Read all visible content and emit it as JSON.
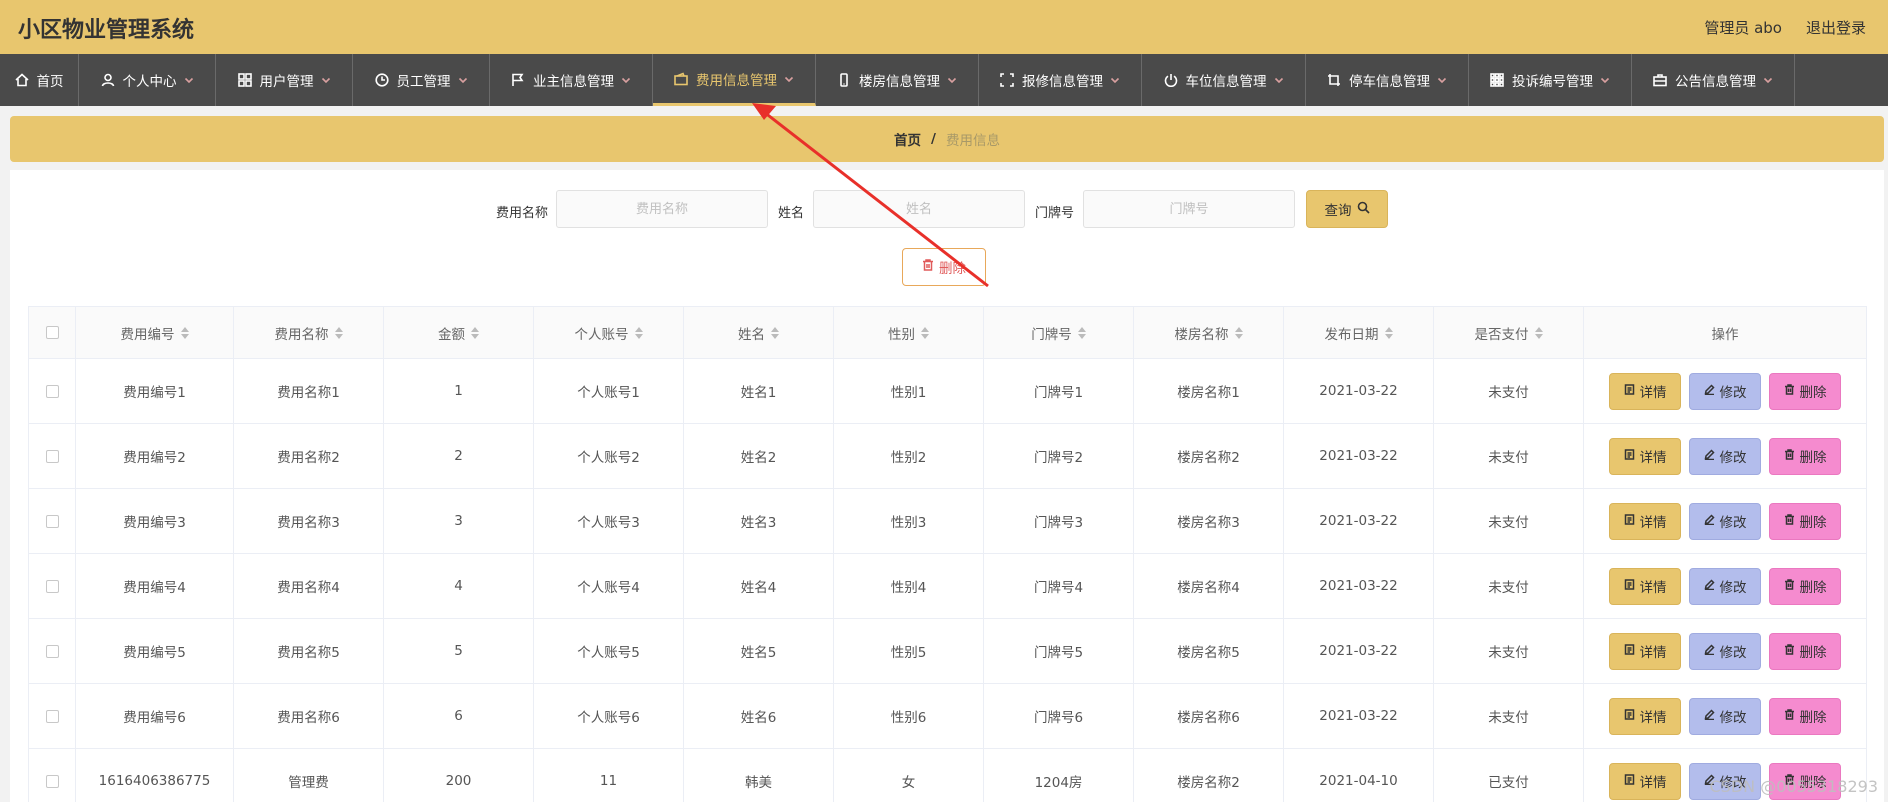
{
  "header": {
    "title": "小区物业管理系统",
    "admin_label": "管理员 abo",
    "logout": "退出登录"
  },
  "nav": {
    "home": "首页",
    "items": [
      {
        "label": "个人中心",
        "icon": "user-icon"
      },
      {
        "label": "用户管理",
        "icon": "grid-icon"
      },
      {
        "label": "员工管理",
        "icon": "clock-icon"
      },
      {
        "label": "业主信息管理",
        "icon": "flag-icon"
      },
      {
        "label": "费用信息管理",
        "icon": "wallet-icon",
        "active": true
      },
      {
        "label": "楼房信息管理",
        "icon": "phone-icon"
      },
      {
        "label": "报修信息管理",
        "icon": "frame-icon"
      },
      {
        "label": "车位信息管理",
        "icon": "power-icon"
      },
      {
        "label": "停车信息管理",
        "icon": "crop-icon"
      },
      {
        "label": "投诉编号管理",
        "icon": "apps-icon"
      },
      {
        "label": "公告信息管理",
        "icon": "briefcase-icon"
      }
    ]
  },
  "breadcrumb": {
    "home": "首页",
    "separator": "/",
    "current": "费用信息"
  },
  "search": {
    "fee_name_label": "费用名称",
    "fee_name_placeholder": "费用名称",
    "name_label": "姓名",
    "name_placeholder": "姓名",
    "door_label": "门牌号",
    "door_placeholder": "门牌号",
    "query_button": "查询"
  },
  "actions": {
    "delete_button": "删除"
  },
  "table": {
    "columns": [
      "费用编号",
      "费用名称",
      "金额",
      "个人账号",
      "姓名",
      "性别",
      "门牌号",
      "楼房名称",
      "发布日期",
      "是否支付",
      "操作"
    ],
    "operation_labels": {
      "detail": "详情",
      "edit": "修改",
      "delete": "删除"
    },
    "rows": [
      [
        "费用编号1",
        "费用名称1",
        "1",
        "个人账号1",
        "姓名1",
        "性别1",
        "门牌号1",
        "楼房名称1",
        "2021-03-22",
        "未支付"
      ],
      [
        "费用编号2",
        "费用名称2",
        "2",
        "个人账号2",
        "姓名2",
        "性别2",
        "门牌号2",
        "楼房名称2",
        "2021-03-22",
        "未支付"
      ],
      [
        "费用编号3",
        "费用名称3",
        "3",
        "个人账号3",
        "姓名3",
        "性别3",
        "门牌号3",
        "楼房名称3",
        "2021-03-22",
        "未支付"
      ],
      [
        "费用编号4",
        "费用名称4",
        "4",
        "个人账号4",
        "姓名4",
        "性别4",
        "门牌号4",
        "楼房名称4",
        "2021-03-22",
        "未支付"
      ],
      [
        "费用编号5",
        "费用名称5",
        "5",
        "个人账号5",
        "姓名5",
        "性别5",
        "门牌号5",
        "楼房名称5",
        "2021-03-22",
        "未支付"
      ],
      [
        "费用编号6",
        "费用名称6",
        "6",
        "个人账号6",
        "姓名6",
        "性别6",
        "门牌号6",
        "楼房名称6",
        "2021-03-22",
        "未支付"
      ],
      [
        "1616406386775",
        "管理费",
        "200",
        "11",
        "韩美",
        "女",
        "1204房",
        "楼房名称2",
        "2021-04-10",
        "已支付"
      ]
    ]
  },
  "watermark": "CSDN @0055318293",
  "colors": {
    "accent": "#e8c66e",
    "nav_bg": "#4a4a4a",
    "edit_button": "#b3bdec",
    "delete_button": "#f58bcf",
    "annotation_arrow": "#e8302a"
  }
}
